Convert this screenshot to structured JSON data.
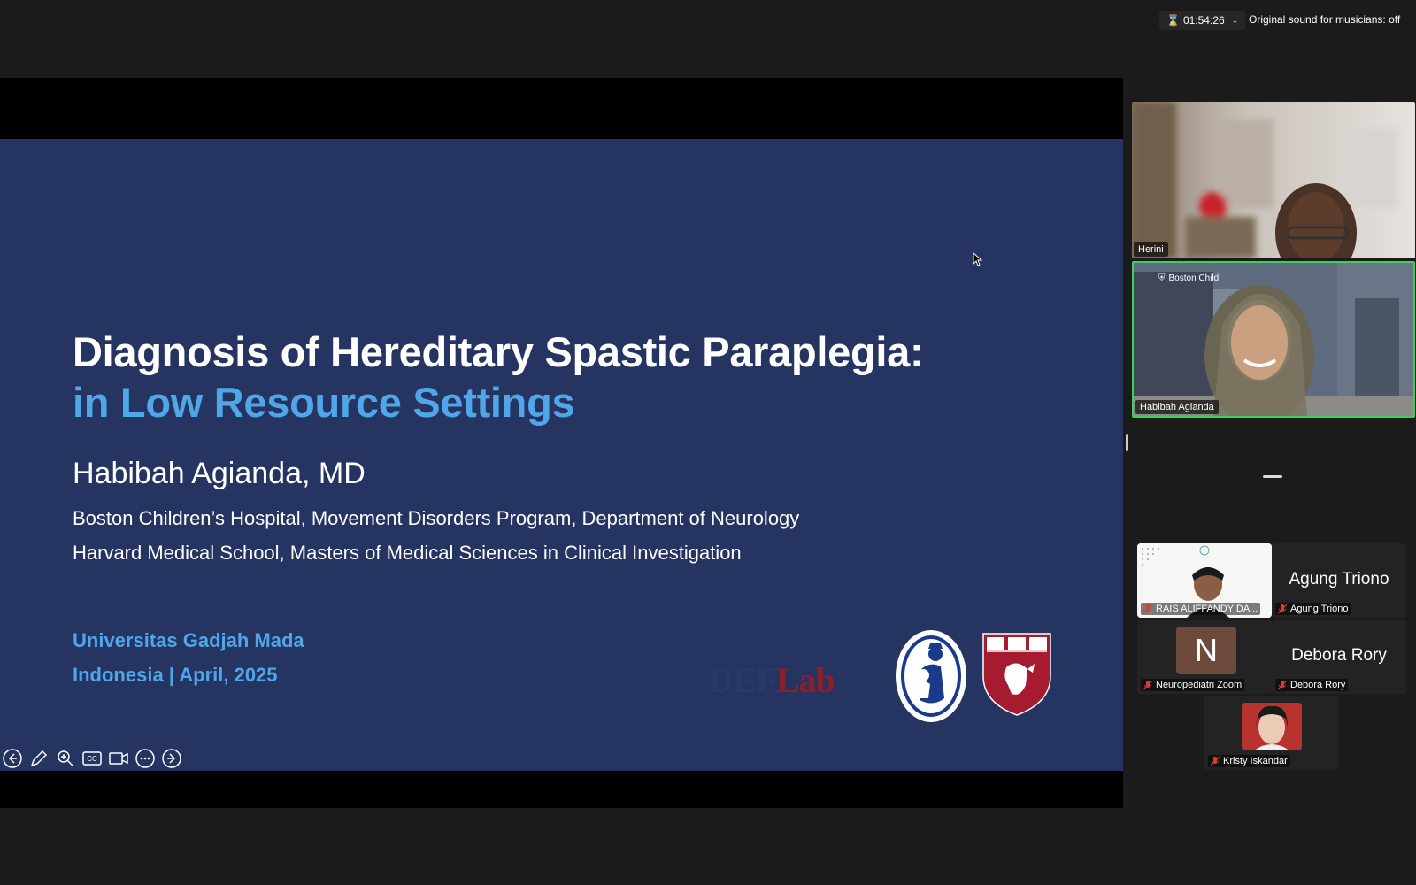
{
  "topbar": {
    "timer": "01:54:26",
    "original_sound": "Original sound for musicians: off"
  },
  "slide": {
    "title": "Diagnosis of Hereditary Spastic Paraplegia:",
    "subtitle": "in Low Resource Settings",
    "presenter": "Habibah Agianda, MD",
    "affiliations": [
      "Boston Children’s Hospital, Movement Disorders Program, Department of Neurology",
      "Harvard Medical School, Masters of Medical Sciences in Clinical Investigation"
    ],
    "event": {
      "university": "Universitas Gadjah Mada",
      "location_date": "Indonesia | April, 2025"
    },
    "logos": {
      "deflab_def": "DEF",
      "deflab_lab": "Lab"
    }
  },
  "slide_controls": [
    "previous-slide",
    "pen",
    "zoom",
    "closed-captions",
    "camera",
    "more-options",
    "next-slide"
  ],
  "videos": [
    {
      "name": "Herini"
    },
    {
      "name": "Habibah Agianda",
      "active_speaker": true,
      "background_tag": "Boston Child"
    }
  ],
  "participants": [
    {
      "tile_text": "",
      "label": "RAIS ALIFFANDY DA...",
      "muted": true
    },
    {
      "tile_text": "Agung Triono",
      "label": "Agung Triono",
      "muted": true
    },
    {
      "tile_text": "N",
      "label": "Neuropediatri Zoom",
      "muted": true
    },
    {
      "tile_text": "Debora Rory",
      "label": "Debora Rory",
      "muted": true
    },
    {
      "tile_text": "",
      "label": "Kristy Iskandar",
      "muted": true
    }
  ],
  "colors": {
    "slide_bg": "#253460",
    "accent_blue": "#4fa6e8",
    "active_speaker_border": "#3cd15a",
    "app_bg": "#1b1b1b"
  }
}
